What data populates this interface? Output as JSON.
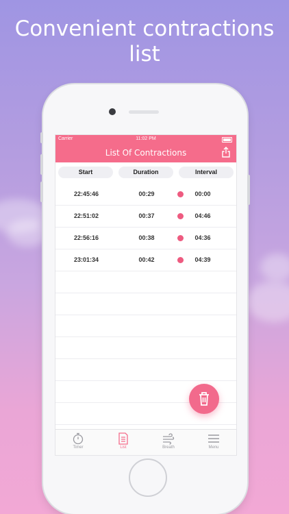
{
  "headline": {
    "line1": "Convenient contractions",
    "line2": "list"
  },
  "status_bar": {
    "carrier": "Carrier",
    "time": "11:02 PM"
  },
  "navbar": {
    "title": "List Of Contractions"
  },
  "columns": {
    "start": "Start",
    "duration": "Duration",
    "interval": "Interval"
  },
  "rows": [
    {
      "start": "22:45:46",
      "duration": "00:29",
      "interval": "00:00"
    },
    {
      "start": "22:51:02",
      "duration": "00:37",
      "interval": "04:46"
    },
    {
      "start": "22:56:16",
      "duration": "00:38",
      "interval": "04:36"
    },
    {
      "start": "23:01:34",
      "duration": "00:42",
      "interval": "04:39"
    }
  ],
  "tabs": {
    "timer": "Timer",
    "list": "List",
    "breath": "Breath",
    "menu": "Menu"
  },
  "colors": {
    "accent": "#f56c8b",
    "dot": "#ee5b80",
    "inactive": "#9a9aa0"
  }
}
